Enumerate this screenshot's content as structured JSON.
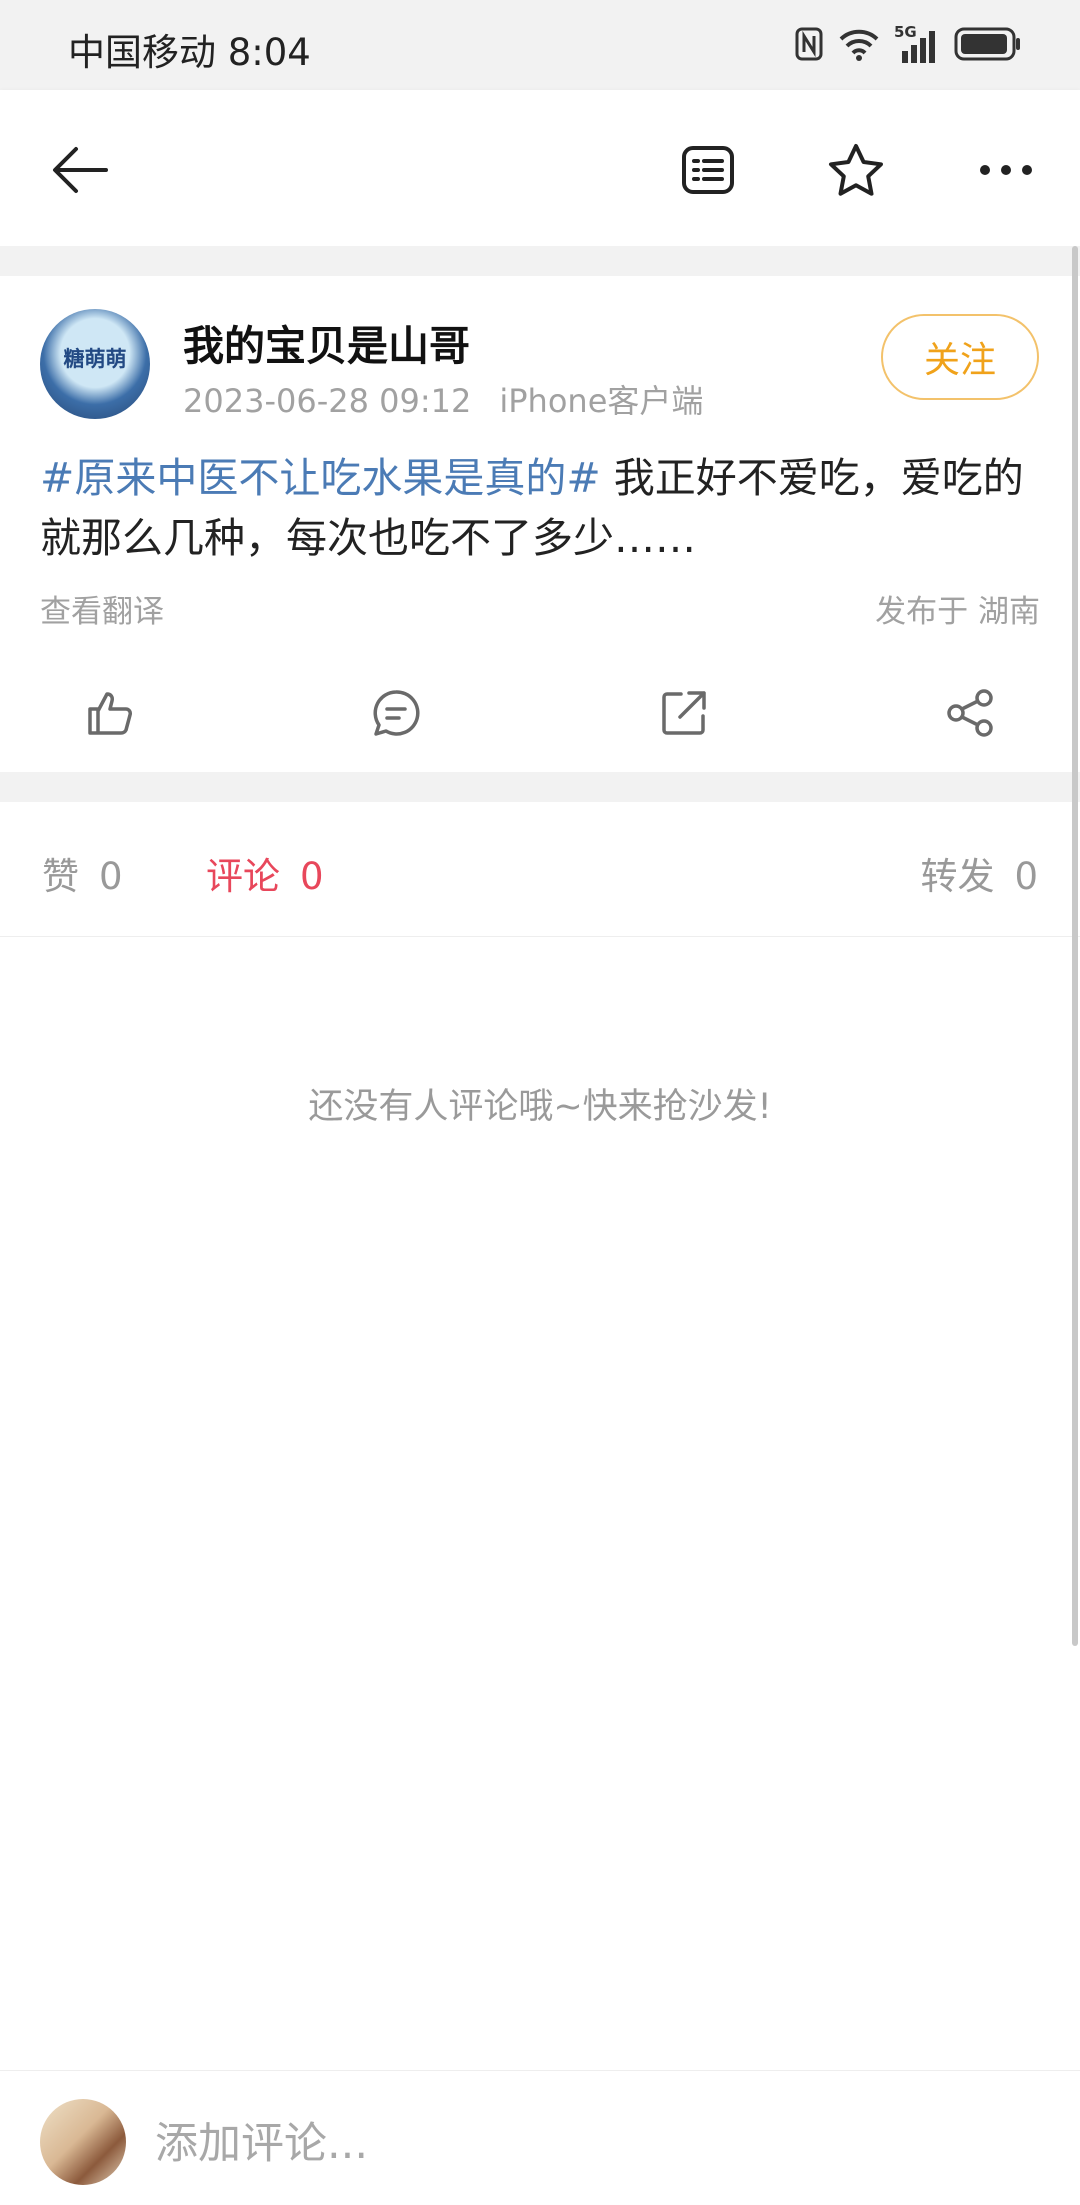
{
  "status_bar": {
    "carrier_time": "中国移动 8:04",
    "network_label": "5G"
  },
  "toolbar": {
    "back_icon": "back-arrow-icon",
    "reader_icon": "reader-mode-icon",
    "favorite_icon": "star-icon",
    "more_icon": "more-dots-icon"
  },
  "post": {
    "avatar_text": "糖萌萌",
    "username": "我的宝贝是山哥",
    "timestamp": "2023-06-28 09:12",
    "source": "iPhone客户端",
    "follow_label": "关注",
    "topic": "#原来中医不让吃水果是真的#",
    "body": " 我正好不爱吃，爱吃的就那么几种，每次也吃不了多少……",
    "translate_label": "查看翻译",
    "location": "发布于 湖南",
    "actions": [
      "like-icon",
      "comment-icon",
      "repost-icon",
      "share-icon"
    ]
  },
  "tabs": {
    "likes_label": "赞",
    "likes_count": "0",
    "comments_label": "评论",
    "comments_count": "0",
    "reposts_label": "转发",
    "reposts_count": "0"
  },
  "empty_state": "还没有人评论哦~快来抢沙发!",
  "bottom_bar": {
    "comment_placeholder": "添加评论..."
  },
  "colors": {
    "accent_red": "#e8475b",
    "topic_blue": "#4b7bb5",
    "follow_orange": "#f0a21a"
  }
}
